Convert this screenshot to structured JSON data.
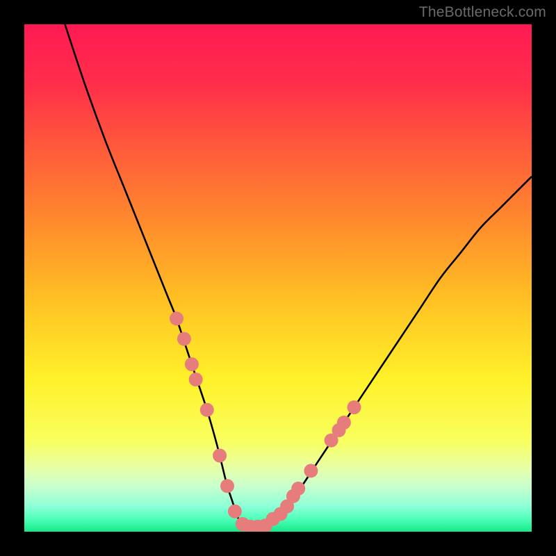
{
  "watermark": "TheBottleneck.com",
  "gradient": {
    "stops": [
      {
        "offset": 0.0,
        "color": "#ff1a53"
      },
      {
        "offset": 0.12,
        "color": "#ff2f4a"
      },
      {
        "offset": 0.25,
        "color": "#ff5c3a"
      },
      {
        "offset": 0.4,
        "color": "#ff8e2c"
      },
      {
        "offset": 0.55,
        "color": "#ffc323"
      },
      {
        "offset": 0.7,
        "color": "#fff12a"
      },
      {
        "offset": 0.82,
        "color": "#f9ff5e"
      },
      {
        "offset": 0.87,
        "color": "#e9ffa1"
      },
      {
        "offset": 0.91,
        "color": "#c9ffcd"
      },
      {
        "offset": 0.95,
        "color": "#8dffd7"
      },
      {
        "offset": 0.975,
        "color": "#4dffb8"
      },
      {
        "offset": 1.0,
        "color": "#17e88a"
      }
    ]
  },
  "chart_data": {
    "type": "line",
    "title": "",
    "xlabel": "",
    "ylabel": "",
    "xlim": [
      0,
      100
    ],
    "ylim": [
      0,
      100
    ],
    "series": [
      {
        "name": "bottleneck-curve",
        "x": [
          8,
          12,
          16,
          20,
          24,
          28,
          30,
          32,
          34,
          36,
          38,
          39,
          40,
          41,
          42,
          43,
          44,
          46,
          48,
          50,
          54,
          58,
          62,
          66,
          70,
          74,
          78,
          82,
          86,
          90,
          94,
          98,
          100
        ],
        "y": [
          100,
          88,
          77,
          67,
          57,
          47,
          42,
          36,
          30,
          24,
          17,
          13,
          9,
          6,
          3,
          1.5,
          1,
          1,
          1.5,
          3,
          8,
          14,
          20,
          26,
          32,
          38,
          44,
          50,
          55,
          60,
          64,
          68,
          70
        ]
      }
    ],
    "scatter": {
      "name": "marker-dots",
      "color": "#e77c7c",
      "radius": 10,
      "points": [
        {
          "x": 30.0,
          "y": 42
        },
        {
          "x": 31.5,
          "y": 38
        },
        {
          "x": 33.0,
          "y": 33
        },
        {
          "x": 33.8,
          "y": 30
        },
        {
          "x": 36.0,
          "y": 24
        },
        {
          "x": 38.5,
          "y": 15
        },
        {
          "x": 40.0,
          "y": 9
        },
        {
          "x": 41.5,
          "y": 4
        },
        {
          "x": 43.0,
          "y": 1.5
        },
        {
          "x": 44.5,
          "y": 1
        },
        {
          "x": 46.0,
          "y": 1
        },
        {
          "x": 47.5,
          "y": 1.2
        },
        {
          "x": 49.0,
          "y": 2.5
        },
        {
          "x": 50.5,
          "y": 3.5
        },
        {
          "x": 51.8,
          "y": 5
        },
        {
          "x": 53.0,
          "y": 7
        },
        {
          "x": 54.0,
          "y": 8.5
        },
        {
          "x": 56.5,
          "y": 12
        },
        {
          "x": 60.5,
          "y": 18
        },
        {
          "x": 62.0,
          "y": 20
        },
        {
          "x": 63.0,
          "y": 21.5
        },
        {
          "x": 65.0,
          "y": 24.5
        }
      ]
    }
  }
}
